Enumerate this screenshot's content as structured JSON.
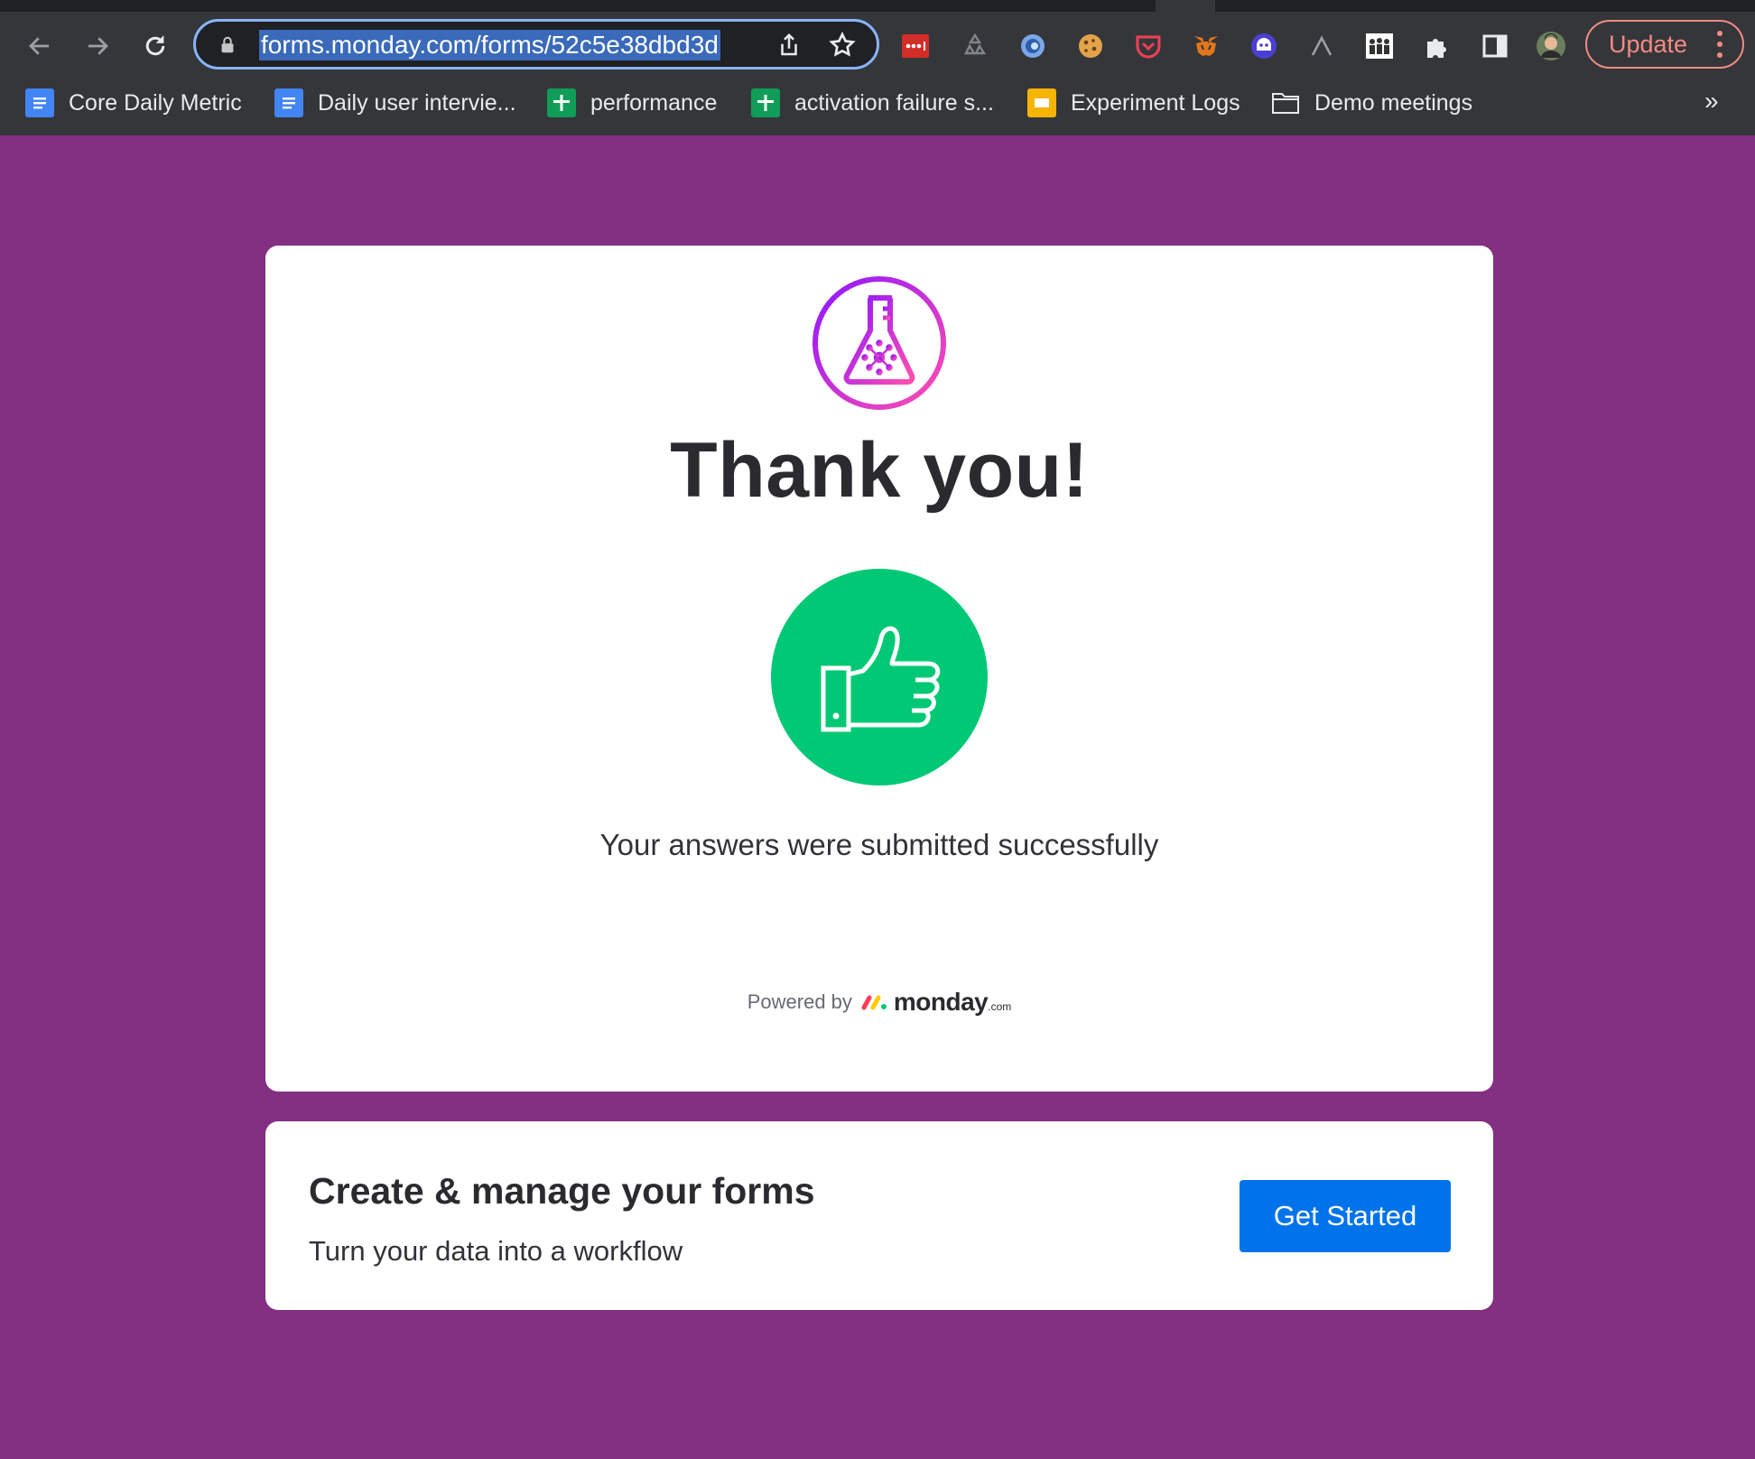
{
  "browser": {
    "url": "forms.monday.com/forms/52c5e38dbd3d",
    "update_label": "Update",
    "extensions": [
      "lastpass-icon",
      "recycle-icon",
      "loop-icon",
      "cookie-icon",
      "pocket-icon",
      "metamask-icon",
      "ghost-bot-icon",
      "caret-icon",
      "crowd-icon",
      "puzzle-extensions-icon",
      "side-panel-icon",
      "profile-avatar"
    ],
    "bookmarks": [
      {
        "label": "Core Daily Metric",
        "icon": "docs-icon"
      },
      {
        "label": "Daily user intervie...",
        "icon": "docs-icon"
      },
      {
        "label": "performance",
        "icon": "sheets-icon"
      },
      {
        "label": "activation failure s...",
        "icon": "sheets-icon"
      },
      {
        "label": "Experiment Logs",
        "icon": "slides-icon"
      },
      {
        "label": "Demo meetings",
        "icon": "folder-icon"
      }
    ],
    "more_bookmarks": "»"
  },
  "form": {
    "title": "Thank you!",
    "message": "Your answers were submitted successfully",
    "powered_by": "Powered by",
    "brand": "monday",
    "brand_suffix": ".com"
  },
  "promo": {
    "heading": "Create & manage your forms",
    "subheading": "Turn your data into a workflow",
    "cta_label": "Get Started"
  },
  "colors": {
    "background": "#832f82",
    "success_green": "#00c875",
    "cta_blue": "#0073ea",
    "logo_gradient_start": "#8f16ff",
    "logo_gradient_end": "#ff4fb0"
  }
}
